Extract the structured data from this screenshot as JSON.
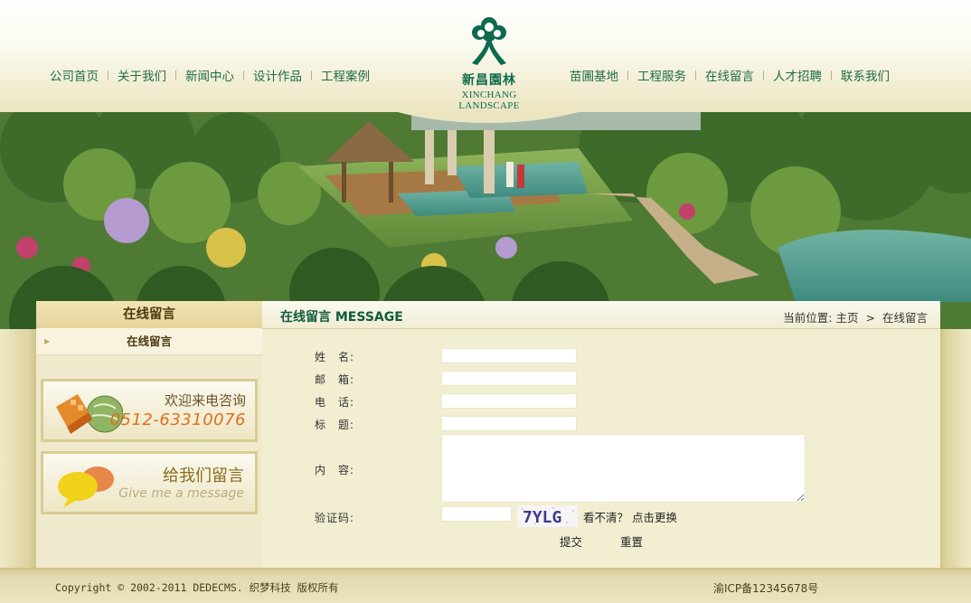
{
  "nav": {
    "left": [
      "公司首页",
      "关于我们",
      "新闻中心",
      "设计作品",
      "工程案例"
    ],
    "right": [
      "苗圃基地",
      "工程服务",
      "在线留言",
      "人才招聘",
      "联系我们"
    ]
  },
  "logo": {
    "cn": "新昌園林",
    "en": "XINCHANG LANDSCAPE"
  },
  "sidebar": {
    "title": "在线留言",
    "items": [
      {
        "label": "在线留言"
      }
    ],
    "promo_phone": {
      "text": "欢迎来电咨询",
      "number": "0512-63310076"
    },
    "promo_message": {
      "title": "给我们留言",
      "subtitle": "Give me a message"
    }
  },
  "content": {
    "title": "在线留言 MESSAGE",
    "breadcrumb": {
      "prefix": "当前位置:",
      "home": "主页",
      "separator": ">",
      "current": "在线留言"
    }
  },
  "form": {
    "name_label": "姓　名:",
    "email_label": "邮　箱:",
    "phone_label": "电　话:",
    "subject_label": "标　题:",
    "content_label": "内　容:",
    "captcha_label": "验证码:",
    "captcha_image_text": "7YLG",
    "captcha_hint": "看不清？ 点击更换",
    "submit": "提交",
    "reset": "重置",
    "values": {
      "name": "",
      "email": "",
      "phone": "",
      "subject": "",
      "content": "",
      "captcha": ""
    }
  },
  "footer": {
    "copyright": "Copyright © 2002-2011 DEDECMS. 织梦科技 版权所有",
    "icp": "渝ICP备12345678号"
  },
  "colors": {
    "nav_text": "#1f6d44",
    "brand_green": "#0c6b4d",
    "page_bg": "#efe9c6",
    "phone_orange": "#e0701c"
  },
  "icons": [
    "tree-logo-icon",
    "arrow-bullet-icon",
    "phone-promo-icon",
    "speech-bubble-icon",
    "captcha-image"
  ]
}
